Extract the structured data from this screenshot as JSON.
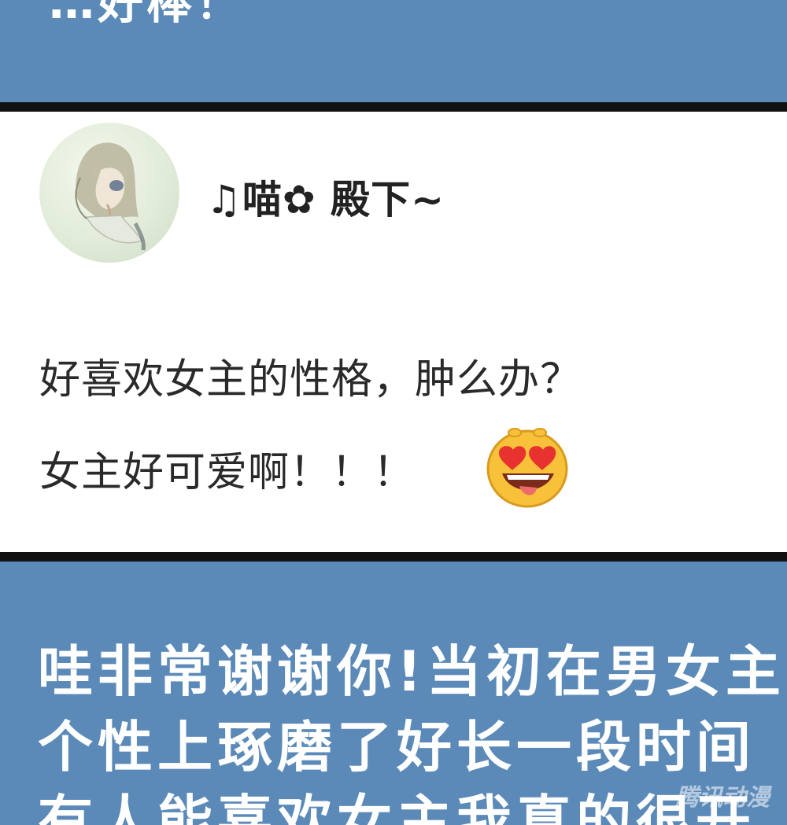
{
  "top_band": {
    "cut_text": "…好棒！"
  },
  "comment": {
    "username": "♫喵✿ 殿下~",
    "lines": [
      "好喜欢女主的性格，肿么办？",
      "女主好可爱啊！！！"
    ],
    "emoji_icon": "heart-eyes-emoji"
  },
  "reply": {
    "lines": [
      "哇非常谢谢你!当初在男女主",
      "个性上琢磨了好长一段时间",
      "有人能喜欢女主我真的很开"
    ]
  },
  "watermark": "腾讯动漫",
  "colors": {
    "band": "#5b8ab9",
    "card": "#ffffff",
    "divider": "#111111",
    "emoji_face": "#f7c13a",
    "emoji_heart": "#e8322f"
  }
}
